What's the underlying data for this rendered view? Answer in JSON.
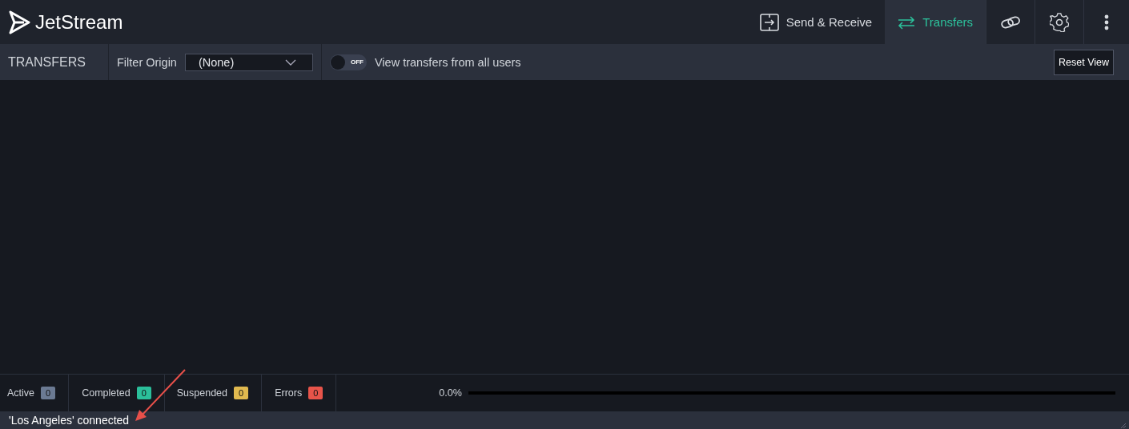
{
  "app": {
    "title": "JetStream"
  },
  "nav": [
    {
      "kind": "send",
      "label": "Send & Receive",
      "selected": false
    },
    {
      "kind": "transfers",
      "label": "Transfers",
      "selected": true
    },
    {
      "kind": "link",
      "selected": false
    },
    {
      "kind": "settings",
      "selected": false
    },
    {
      "kind": "more",
      "selected": false
    }
  ],
  "toolbar": {
    "title": "TRANSFERS",
    "filter_label": "Filter Origin",
    "filter_value": "(None)",
    "toggle": {
      "on": false,
      "text": "OFF",
      "label": "View transfers from all users"
    },
    "reset_button": "Reset View"
  },
  "counters": [
    {
      "label": "Active",
      "count": "0",
      "color": "#6b7a93"
    },
    {
      "label": "Completed",
      "count": "0",
      "color": "#2bbf9b"
    },
    {
      "label": "Suspended",
      "count": "0",
      "color": "#e0b94f"
    },
    {
      "label": "Errors",
      "count": "0",
      "color": "#e8544a"
    }
  ],
  "progress": {
    "reading": "0.0%",
    "level": 0
  },
  "status_bar": {
    "text": "'Los Angeles' connected"
  },
  "annotation": {
    "kind": "arrow"
  }
}
